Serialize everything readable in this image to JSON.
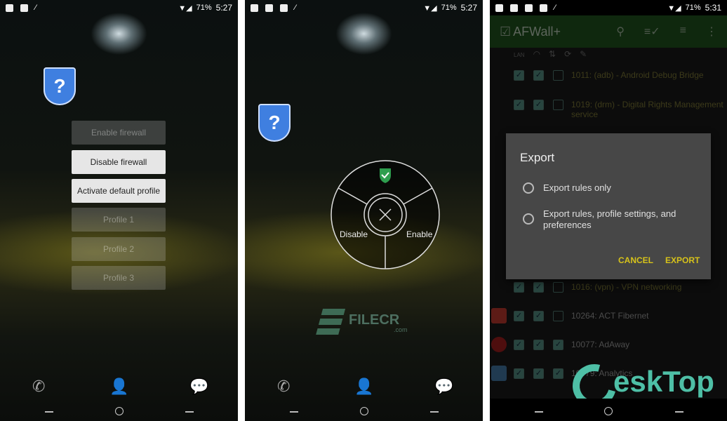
{
  "status_bars": [
    {
      "battery": "71%",
      "time": "5:27"
    },
    {
      "battery": "71%",
      "time": "5:27"
    },
    {
      "battery": "71%",
      "time": "5:31"
    }
  ],
  "widget_menu": {
    "status_icon": "question-shield-icon",
    "buttons": [
      {
        "label": "Enable firewall",
        "enabled": false
      },
      {
        "label": "Disable firewall",
        "enabled": true
      },
      {
        "label": "Activate default profile",
        "enabled": true
      },
      {
        "label": "Profile 1",
        "enabled": false
      },
      {
        "label": "Profile 2",
        "enabled": false
      },
      {
        "label": "Profile 3",
        "enabled": false
      }
    ]
  },
  "radial_menu": {
    "top_icon": "green-check-shield-icon",
    "left_label": "Disable",
    "right_label": "Enable",
    "center_icon": "close-icon"
  },
  "watermark_mid": {
    "text": "FILECR",
    "sub": ".com"
  },
  "app": {
    "title": "AFWall+",
    "actions": [
      "search-icon",
      "select-all-icon",
      "sort-icon",
      "more-vert-icon"
    ],
    "column_icons": [
      "LAN",
      "wifi-icon",
      "data-icon",
      "roaming-icon",
      "vpn-icon"
    ],
    "rows": [
      {
        "label": "1011: (adb) - Android Debug Bridge",
        "checks": [
          true,
          true,
          false
        ]
      },
      {
        "label": "1019: (drm) - Digital Rights Management service",
        "checks": [
          true,
          true,
          false
        ]
      },
      {
        "label": "1016: (vpn) - VPN networking",
        "checks": [
          true,
          true,
          false
        ]
      },
      {
        "label": "10264: ACT Fibernet",
        "checks": [
          true,
          true,
          false
        ],
        "icon_color": "#c0392b"
      },
      {
        "label": "10077: AdAway",
        "checks": [
          true,
          true,
          true
        ],
        "icon_color": "#b71c1c"
      },
      {
        "label": "10079: Analytics",
        "checks": [
          true,
          true,
          true
        ],
        "icon_color": "#4a7fb0"
      }
    ]
  },
  "dialog": {
    "title": "Export",
    "options": [
      "Export rules only",
      "Export rules, profile settings, and preferences"
    ],
    "cancel": "CANCEL",
    "confirm": "EXPORT"
  },
  "watermark_right": {
    "text": "eskTop"
  },
  "colors": {
    "appbar": "#1c4a1a",
    "accent": "#d6c21a",
    "shield_blue": "#3f7fe0"
  }
}
